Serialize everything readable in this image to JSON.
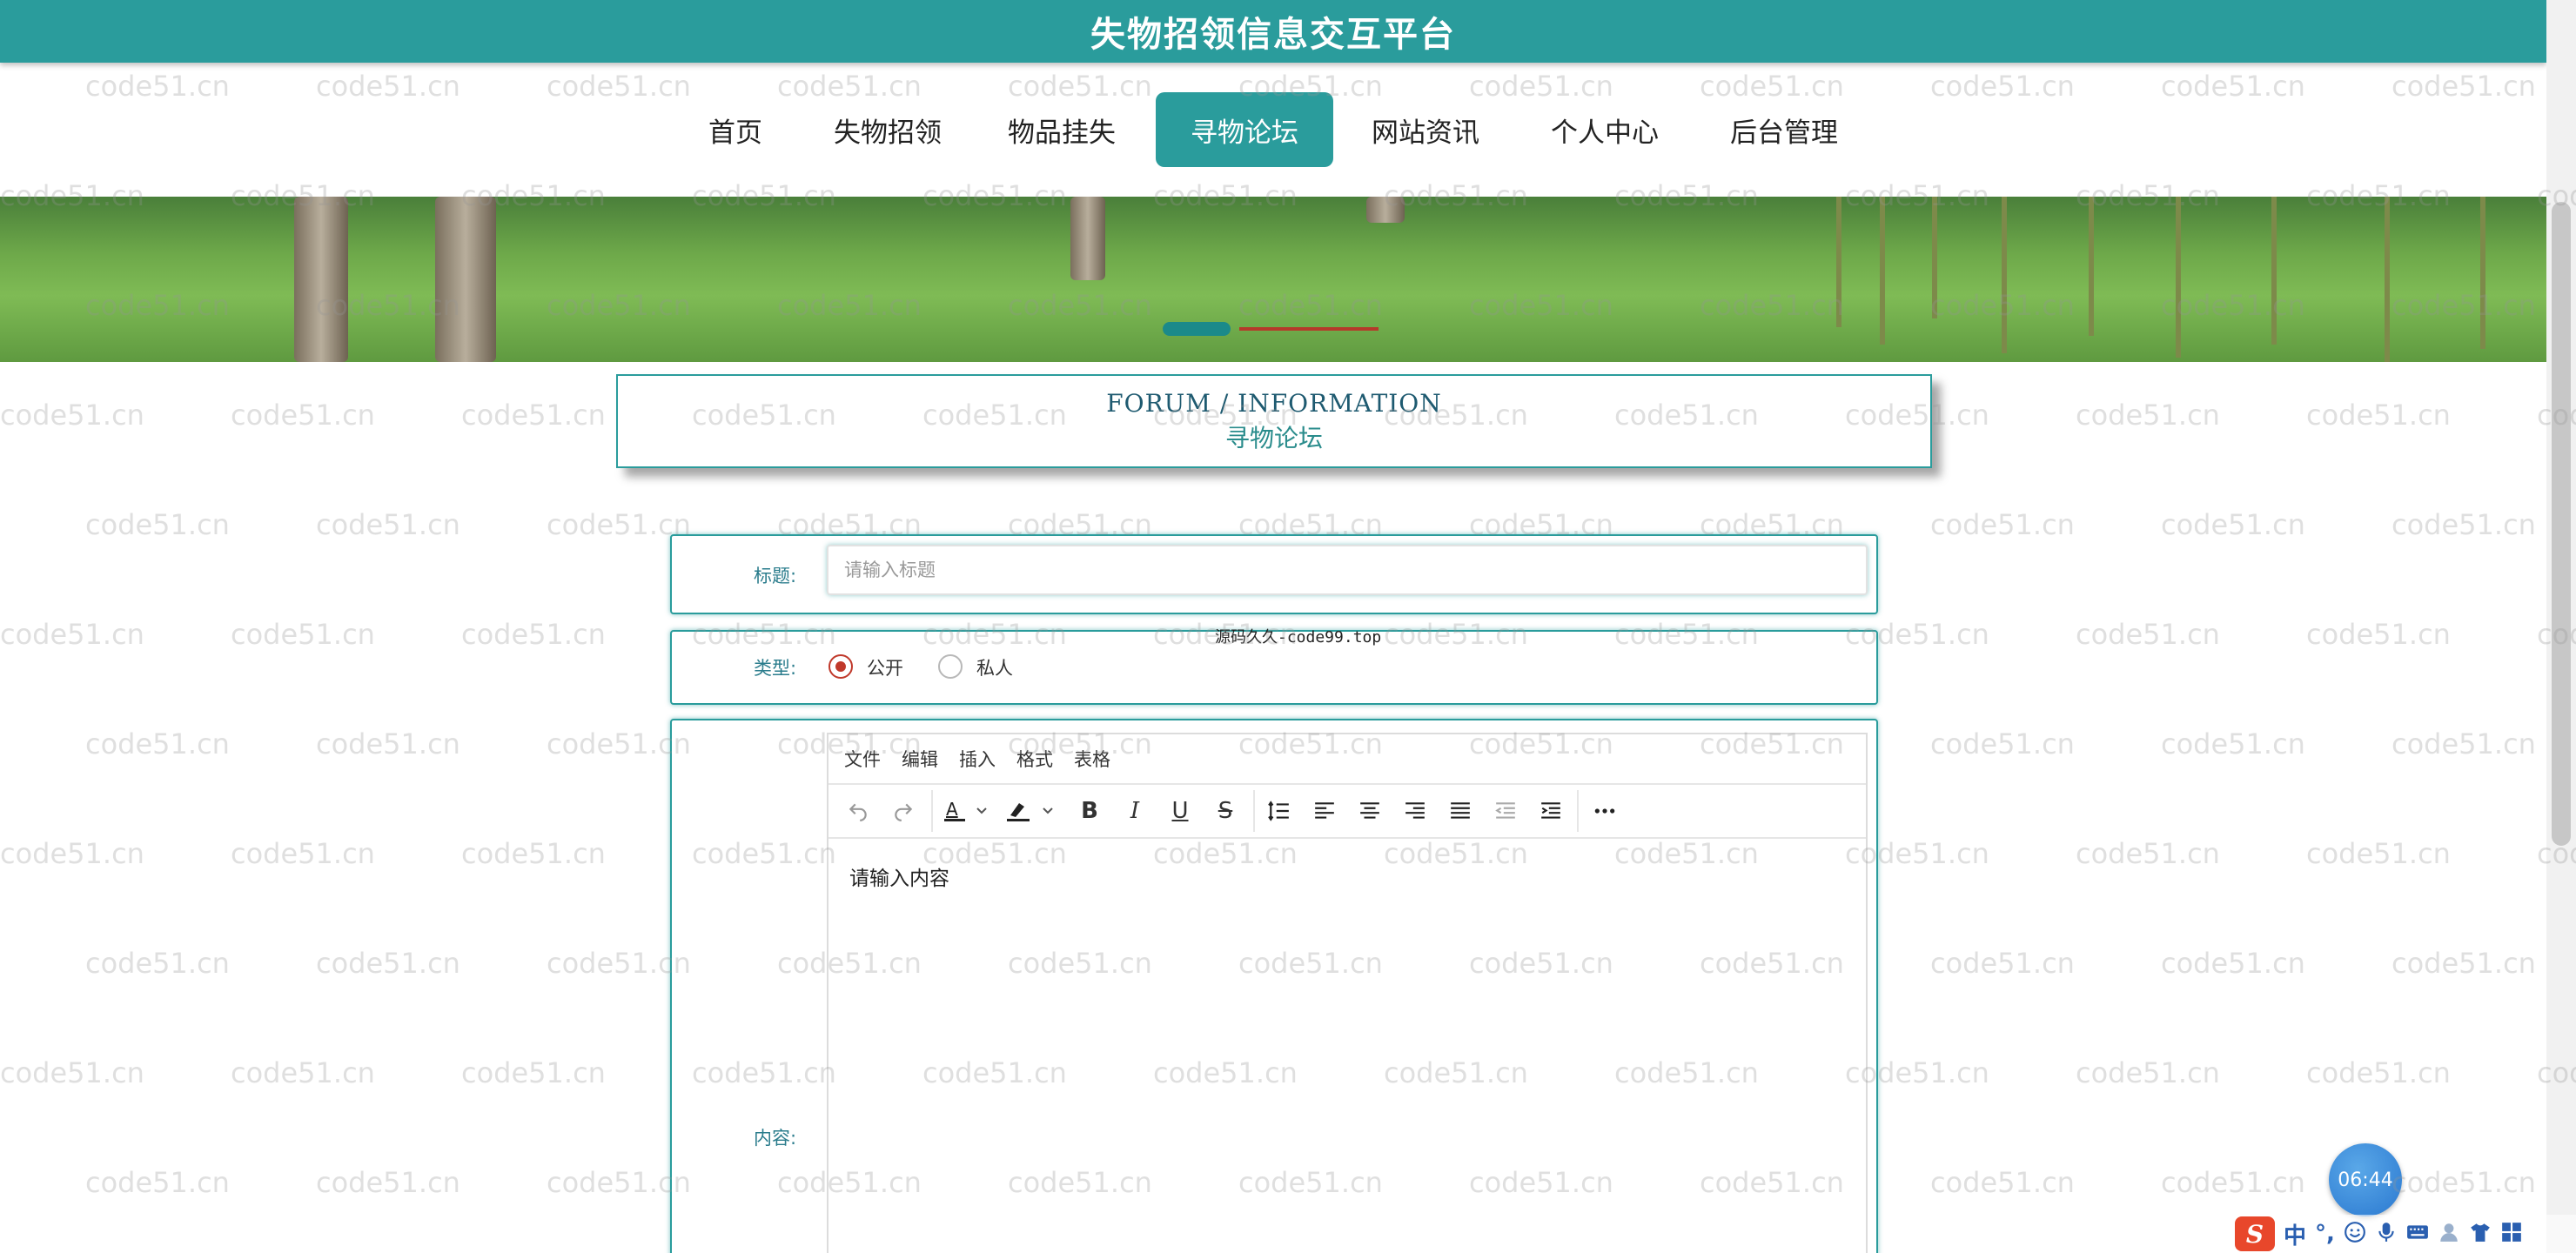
{
  "header": {
    "site_title": "失物招领信息交互平台"
  },
  "nav": {
    "items": [
      {
        "label": "首页",
        "active": false
      },
      {
        "label": "失物招领",
        "active": false
      },
      {
        "label": "物品挂失",
        "active": false
      },
      {
        "label": "寻物论坛",
        "active": true
      },
      {
        "label": "网站资讯",
        "active": false
      },
      {
        "label": "个人中心",
        "active": false
      },
      {
        "label": "后台管理",
        "active": false
      }
    ]
  },
  "section": {
    "title_en": "FORUM / INFORMATION",
    "title_cn": "寻物论坛"
  },
  "form": {
    "title_label": "标题:",
    "title_placeholder": "请输入标题",
    "type_label": "类型:",
    "type_options": [
      {
        "label": "公开",
        "checked": true
      },
      {
        "label": "私人",
        "checked": false
      }
    ],
    "content_label": "内容:",
    "editor": {
      "menus": [
        "文件",
        "编辑",
        "插入",
        "格式",
        "表格"
      ],
      "toolbar_icons": [
        "undo-icon",
        "redo-icon",
        "text-color-icon",
        "highlight-color-icon",
        "bold-icon",
        "italic-icon",
        "underline-icon",
        "strikethrough-icon",
        "line-height-icon",
        "align-left-icon",
        "align-center-icon",
        "align-right-icon",
        "align-justify-icon",
        "outdent-icon",
        "indent-icon",
        "more-icon"
      ],
      "placeholder": "请输入内容"
    }
  },
  "source_note": "源码久久-code99.top",
  "watermark_text": "code51.cn",
  "clock": "06:44",
  "ime": {
    "lang": "中",
    "punct": "°,"
  },
  "colors": {
    "primary": "#2a9c9c",
    "radio_checked": "#c0392b"
  }
}
